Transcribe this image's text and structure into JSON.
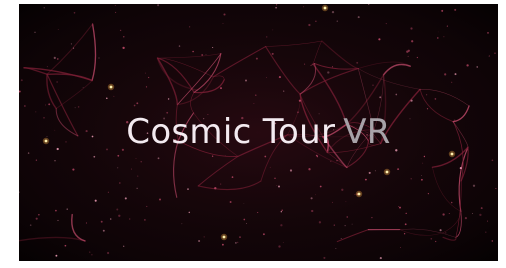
{
  "splash": {
    "title_main": "Cosmic Tour",
    "title_suffix": "VR"
  },
  "colors": {
    "background": "#0b0305",
    "filament": "#7a1e34",
    "filament_bright": "#c24a6a",
    "glow": "#ffb347",
    "title_main": "#f3eaf0",
    "title_suffix": "#a7a2a8"
  }
}
